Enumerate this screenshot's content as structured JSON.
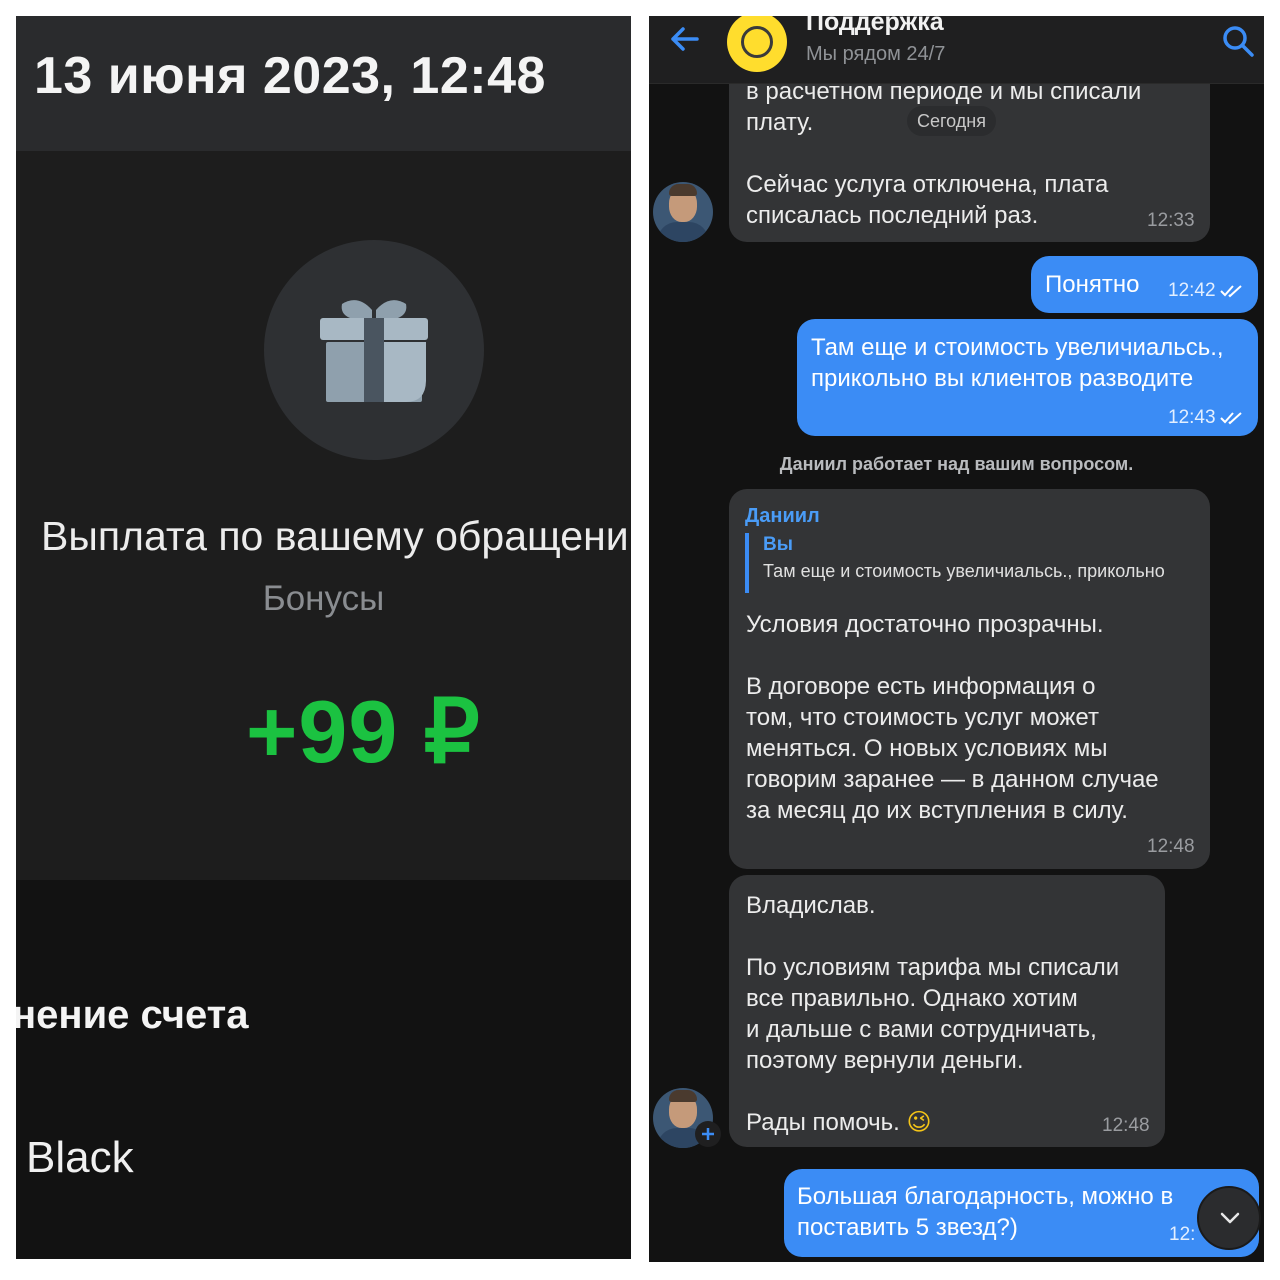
{
  "left": {
    "date": "13 июня 2023, 12:48",
    "icon": "gift-icon",
    "title": "Выплата по вашему обращению",
    "category": "Бонусы",
    "amount": "+99 ₽",
    "amount_color": "#1bc241",
    "section_title": "нение счета",
    "account_label": "Black"
  },
  "chat": {
    "title": "Поддержка",
    "subtitle": "Мы рядом 24/7",
    "date_chip": "Сегодня",
    "messages": [
      {
        "lines": [
          "в расчетном периоде и мы списали",
          "плату.",
          "",
          "Сейчас услуга отключена, плата",
          "списалась последний раз."
        ],
        "time": "12:33"
      },
      {
        "text": "Понятно",
        "time": "12:42"
      },
      {
        "lines": [
          "Там еще и стоимость увеличиальсь.,",
          "прикольно вы клиентов разводите"
        ],
        "time": "12:43"
      }
    ],
    "system_note": "Даниил работает над вашим вопросом.",
    "reply_message": {
      "author": "Даниил",
      "quote_author": "Вы",
      "quote_text": "Там еще и стоимость увеличиальсь., прикольно",
      "lines": [
        "Условия достаточно прозрачны.",
        "",
        "В договоре есть информация о",
        "том, что стоимость услуг может",
        "меняться. О новых условиях мы",
        "говорим заранее — в данном случае",
        "за месяц до их вступления в силу."
      ],
      "time": "12:48"
    },
    "second_message": {
      "lines": [
        "Владислав.",
        "",
        "По условиям тарифа мы списали",
        "все правильно. Однако хотим",
        "и дальше с вами сотрудничать,",
        "поэтому вернули деньги.",
        "",
        "Рады помочь."
      ],
      "emoji": "😉",
      "time": "12:48"
    },
    "last_message": {
      "lines": [
        "Большая благодарность, можно в",
        "поставить 5 звезд?)"
      ],
      "time": "12:"
    },
    "accent": "#3b8cf5"
  }
}
